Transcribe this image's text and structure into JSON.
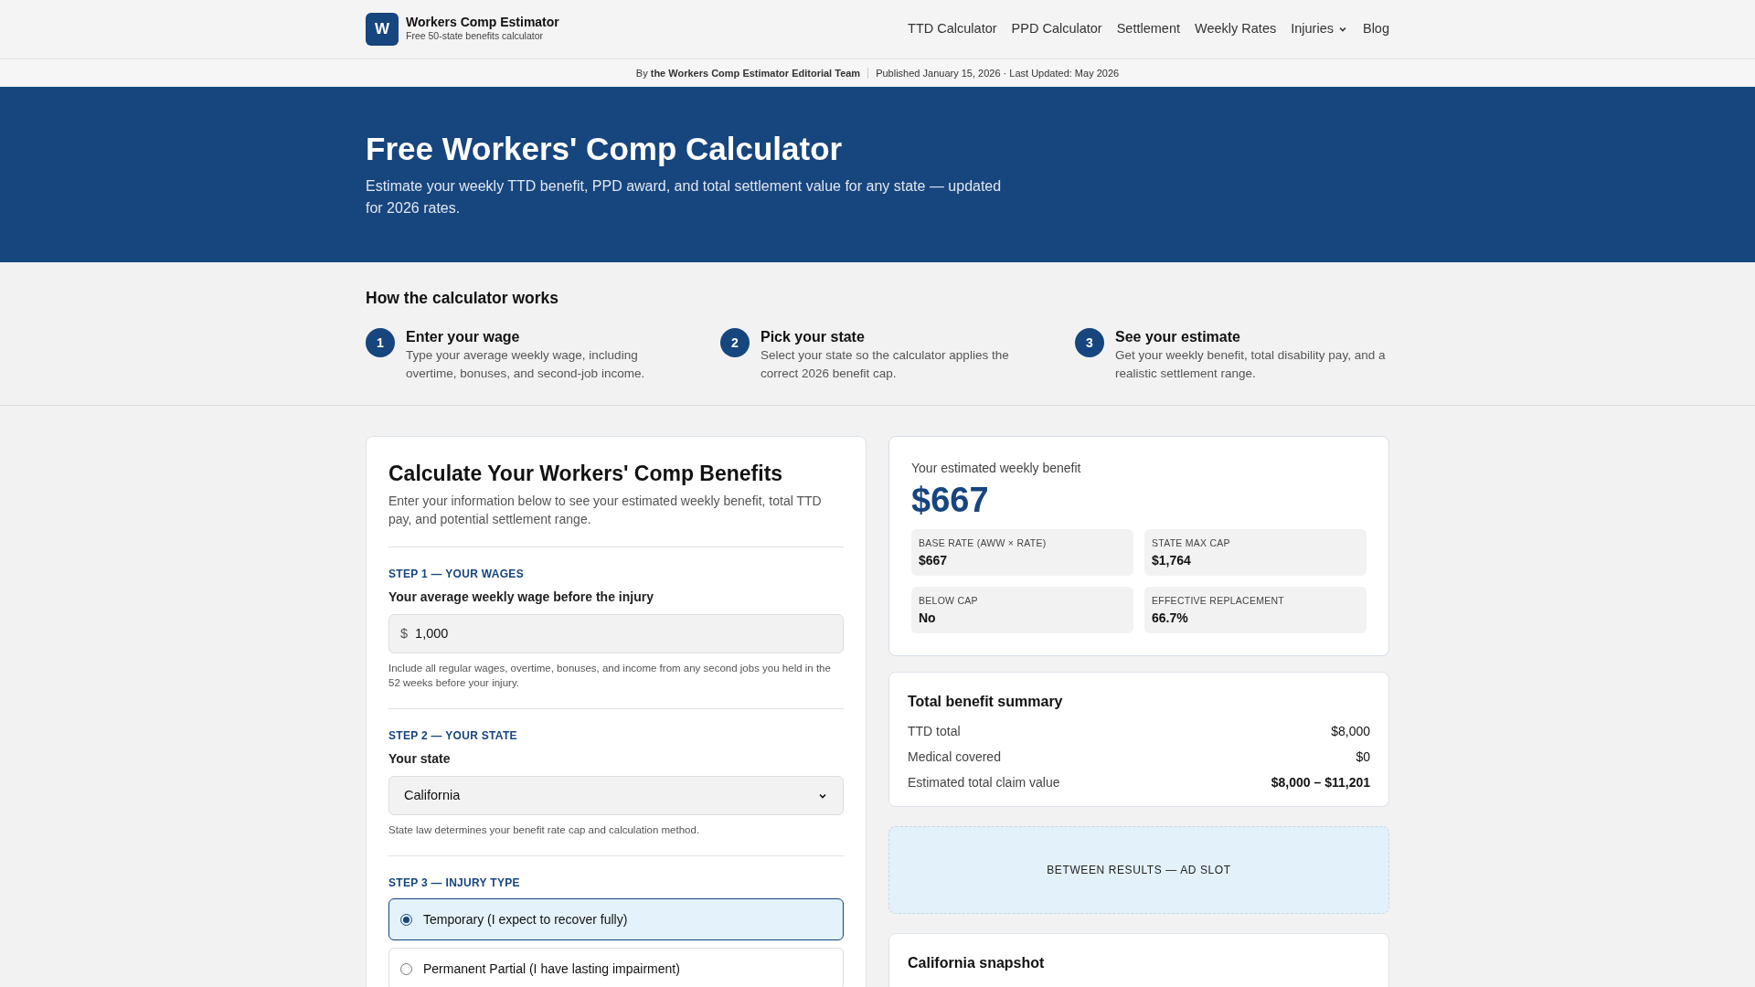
{
  "brand": {
    "logo_letter": "W",
    "name": "Workers Comp Estimator",
    "tagline": "Free 50-state benefits calculator"
  },
  "nav": [
    {
      "label": "TTD Calculator",
      "kind": "link"
    },
    {
      "label": "PPD Calculator",
      "kind": "link"
    },
    {
      "label": "Settlement",
      "kind": "link"
    },
    {
      "label": "Weekly Rates",
      "kind": "link"
    },
    {
      "label": "Injuries",
      "kind": "dropdown"
    },
    {
      "label": "Blog",
      "kind": "link"
    }
  ],
  "byline": {
    "author": "By **the Workers Comp Estimator Editorial Team**",
    "dates": "Published January 15, 2026 · Last Updated: May 2026"
  },
  "hero": {
    "title": "Free Workers' Comp Calculator",
    "subtitle": "Estimate your weekly TTD benefit, PPD award, and total settlement value for any state — updated for 2026 rates."
  },
  "how_it_works": {
    "title": "How the calculator works",
    "steps": [
      {
        "number": "1",
        "title": "Enter your wage",
        "text": "Type your average weekly wage, including overtime, bonuses, and second-job income."
      },
      {
        "number": "2",
        "title": "Pick your state",
        "text": "Select your state so the calculator applies the correct 2026 benefit cap."
      },
      {
        "number": "3",
        "title": "See your estimate",
        "text": "Get your weekly benefit, total disability pay, and a realistic settlement range."
      }
    ]
  },
  "calculator": {
    "title": "Calculate Your Workers' Comp Benefits",
    "intro": "Enter your information below to see your estimated weekly benefit, total TTD pay, and potential settlement range.",
    "wage": {
      "step": "STEP 1 — YOUR WAGES",
      "label": "Your average weekly wage before the injury",
      "prefix": "$",
      "value": "1,000",
      "help": "Include all regular wages, overtime, bonuses, and income from any second jobs you held in the 52 weeks before your injury."
    },
    "state": {
      "step": "STEP 2 — YOUR STATE",
      "label": "Your state",
      "value": "California",
      "help": "State law determines your benefit rate cap and calculation method."
    },
    "injury": {
      "step": "STEP 3 — INJURY TYPE",
      "options": [
        {
          "label": "Temporary (I expect to recover fully)",
          "selected": true
        },
        {
          "label": "Permanent Partial (I have lasting impairment)",
          "selected": false
        }
      ]
    }
  },
  "result": {
    "label": "Your estimated weekly benefit",
    "amount": "$667",
    "stats": [
      {
        "label": "BASE RATE (AWW × RATE)",
        "value": "$667"
      },
      {
        "label": "STATE MAX CAP",
        "value": "$1,764"
      },
      {
        "label": "BELOW CAP",
        "value": "No"
      },
      {
        "label": "EFFECTIVE REPLACEMENT",
        "value": "66.7%"
      }
    ]
  },
  "summary": {
    "title": "Total benefit summary",
    "rows": [
      {
        "label": "TTD total",
        "value": "$8,000",
        "emphasis": false
      },
      {
        "label": "Medical covered",
        "value": "$0",
        "emphasis": false
      },
      {
        "label": "Estimated total claim value",
        "value": "$8,000 – $11,201",
        "emphasis": true
      }
    ]
  },
  "ad_slot": "BETWEEN RESULTS — AD SLOT",
  "snapshot": {
    "title": "California snapshot"
  }
}
